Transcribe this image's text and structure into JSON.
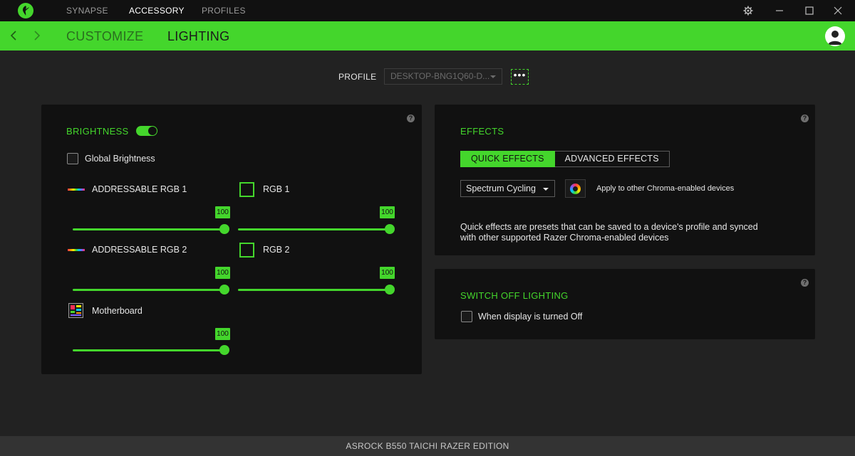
{
  "app": {
    "logo_icon": "razer-logo-icon",
    "top_tabs": [
      {
        "label": "SYNAPSE",
        "active": false
      },
      {
        "label": "ACCESSORY",
        "active": true
      },
      {
        "label": "PROFILES",
        "active": false
      }
    ]
  },
  "sub_nav": {
    "tabs": [
      {
        "label": "CUSTOMIZE",
        "active": false
      },
      {
        "label": "LIGHTING",
        "active": true
      }
    ]
  },
  "profile": {
    "label": "PROFILE",
    "selected": "DESKTOP-BNG1Q60-D...",
    "more_label": "•••"
  },
  "brightness": {
    "title": "BRIGHTNESS",
    "toggle_on": true,
    "global_label": "Global Brightness",
    "help": "?",
    "zones": [
      {
        "name": "ADDRESSABLE RGB 1",
        "value": "100",
        "level_percent": 100,
        "icon": "led-strip-icon"
      },
      {
        "name": "RGB 1",
        "value": "100",
        "level_percent": 100,
        "icon": "rgb-header-icon"
      },
      {
        "name": "ADDRESSABLE RGB 2",
        "value": "100",
        "level_percent": 100,
        "icon": "led-strip-icon"
      },
      {
        "name": "RGB 2",
        "value": "100",
        "level_percent": 100,
        "icon": "rgb-header-icon"
      },
      {
        "name": "Motherboard",
        "value": "100",
        "level_percent": 100,
        "icon": "motherboard-icon"
      }
    ]
  },
  "effects": {
    "title": "EFFECTS",
    "help": "?",
    "tabs": [
      {
        "label": "QUICK EFFECTS",
        "active": true
      },
      {
        "label": "ADVANCED EFFECTS",
        "active": false
      }
    ],
    "selected_effect": "Spectrum Cycling",
    "apply_label": "Apply to other Chroma-enabled devices",
    "description": "Quick effects are presets that can be saved to a device's profile and synced with other supported Razer Chroma-enabled devices"
  },
  "switch_off": {
    "title": "SWITCH OFF LIGHTING",
    "help": "?",
    "option_label": "When display is turned Off"
  },
  "footer": {
    "device_name": "ASROCK B550 TAICHI RAZER EDITION"
  },
  "colors": {
    "accent": "#44d62c",
    "panel": "#111111",
    "background": "#222222"
  }
}
